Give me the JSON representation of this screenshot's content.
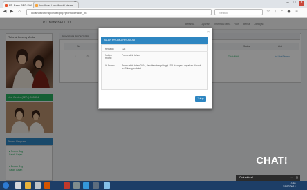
{
  "browser": {
    "tabs": [
      {
        "label": "PT. Bank BPD DIY"
      },
      {
        "label": "localhost / localhost / ideaa..."
      }
    ],
    "url": "localhost/oterapi/index.php/promo/detailin_ph",
    "search_placeholder": "Search",
    "new_tab": "+"
  },
  "site": {
    "title": "PT. Bank BPD DIY",
    "menu": [
      "Beranda",
      "Layanan",
      "Informasi Mitra",
      "Fitur",
      "Berita",
      "Jaringan"
    ],
    "sidebar": {
      "tutorial_title": "Tutorial Cabang Media",
      "live_chat_title": "Live Center (0274) 565454",
      "promo_title": "Promo Program",
      "promo_items": [
        "Promo Bag Salah Gajah",
        "Promo Bag Salah Gajah"
      ]
    },
    "main": {
      "header": "PROGRAM PROMO SPA...",
      "columns": [
        "No",
        "Status",
        "Aksi"
      ],
      "row": {
        "no": "1",
        "code": "123",
        "status": "Tidak Aktif",
        "action": "Lihat Promo"
      }
    }
  },
  "modal": {
    "title": "BILAN PROMO PROMOSI",
    "close": "×",
    "fields": [
      {
        "label": "Kegiatan",
        "value": "123"
      },
      {
        "label": "Subjek Promo",
        "value": "Promo akhir tahun"
      },
      {
        "label": "Isi Promo",
        "value": "Promo akhir tahun 2014, dapatkan bunga tinggi 11,5 %, segera dapatkan di bank-an Cabang terdekat"
      }
    ],
    "button_label": "Tutup"
  },
  "chat": {
    "badge": "CHAT!",
    "bar_label": "Chat with us!"
  },
  "taskbar": {
    "clock_time": "10:55",
    "clock_date": "15/12/2014"
  },
  "colors": {
    "modal_header": "#2e86c1",
    "taskbar": "#1d3e67",
    "chat_bar": "#2b2b2b"
  }
}
